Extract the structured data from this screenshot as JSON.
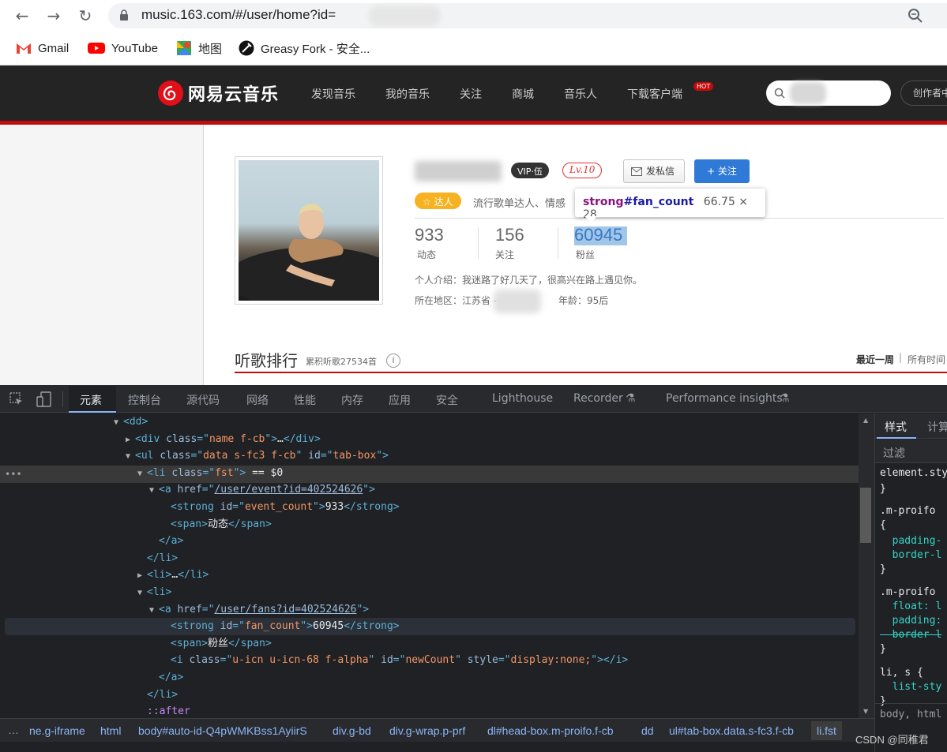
{
  "browser": {
    "url": "music.163.com/#/user/home?id=",
    "bookmarks": [
      {
        "label": "Gmail",
        "icon": "gmail-icon"
      },
      {
        "label": "YouTube",
        "icon": "youtube-icon"
      },
      {
        "label": "地图",
        "icon": "maps-icon"
      },
      {
        "label": "Greasy Fork - 安全...",
        "icon": "greasyfork-icon"
      }
    ]
  },
  "site": {
    "logo": "网易云音乐",
    "nav": [
      "发现音乐",
      "我的音乐",
      "关注",
      "商城",
      "音乐人",
      "下载客户端"
    ],
    "hot_badge": "HOT",
    "creator_center": "创作者中心",
    "brand_color": "#c20c0c"
  },
  "profile": {
    "vip_badge": "VIP·伍",
    "level": "Lv.10",
    "message_button": "发私信",
    "follow_button": "+ 关注",
    "daren_badge": "☆ 达人",
    "description": "流行歌单达人、情感",
    "stats": [
      {
        "value": "933",
        "label": "动态"
      },
      {
        "value": "156",
        "label": "关注"
      },
      {
        "value": "60945",
        "label": "粉丝"
      }
    ],
    "intro": "个人介绍：我迷路了好几天了，很高兴在路上遇见你。",
    "region_label": "所在地区：江苏省 -",
    "age": "年龄：95后"
  },
  "tooltip": {
    "tag": "strong",
    "id": "#fan_count",
    "size": "66.75 × 28"
  },
  "ranking": {
    "title": "听歌排行",
    "subtitle": "累积听歌27534首",
    "info": "i",
    "week": "最近一周",
    "pipe": "|",
    "all": "所有时间"
  },
  "devtools": {
    "tabs": [
      "元素",
      "控制台",
      "源代码",
      "网络",
      "性能",
      "内存",
      "应用",
      "安全",
      "Lighthouse",
      "Recorder",
      "Performance insights"
    ],
    "active_tab": "元素",
    "dom_lines": [
      {
        "indent": 0,
        "tri": "▼",
        "html": "<span class=\"tag\">&lt;dd&gt;</span>"
      },
      {
        "indent": 1,
        "tri": "▶",
        "html": "<span class=\"tag\">&lt;div </span><span class=\"an\">class</span><span class=\"tag\">=\"</span><span class=\"av\">name f-cb</span><span class=\"tag\">\"&gt;</span><span class=\"txt\">…</span><span class=\"tag\">&lt;/div&gt;</span>"
      },
      {
        "indent": 1,
        "tri": "▼",
        "html": "<span class=\"tag\">&lt;ul </span><span class=\"an\">class</span><span class=\"tag\">=\"</span><span class=\"av\">data s-fc3 f-cb</span><span class=\"tag\">\" </span><span class=\"an\">id</span><span class=\"tag\">=\"</span><span class=\"av\">tab-box</span><span class=\"tag\">\"&gt;</span>"
      },
      {
        "indent": 2,
        "tri": "▼",
        "html": "<span class=\"tag\">&lt;li </span><span class=\"an\">class</span><span class=\"tag\">=\"</span><span class=\"av\">fst</span><span class=\"tag\">\"&gt;</span><span class=\"txt\"> == $0</span>"
      },
      {
        "indent": 3,
        "tri": "▼",
        "html": "<span class=\"tag\">&lt;a </span><span class=\"an\">href</span><span class=\"tag\">=\"</span><span class=\"link\">/user/event?id=402524626</span><span class=\"tag\">\"&gt;</span>"
      },
      {
        "indent": 4,
        "tri": "",
        "html": "<span class=\"tag\">&lt;strong </span><span class=\"an\">id</span><span class=\"tag\">=\"</span><span class=\"av\">event_count</span><span class=\"tag\">\"&gt;</span><span class=\"txt\">933</span><span class=\"tag\">&lt;/strong&gt;</span>"
      },
      {
        "indent": 4,
        "tri": "",
        "html": "<span class=\"tag\">&lt;span&gt;</span><span class=\"txt\">动态</span><span class=\"tag\">&lt;/span&gt;</span>"
      },
      {
        "indent": 3,
        "tri": "",
        "html": "<span class=\"tag\">&lt;/a&gt;</span>"
      },
      {
        "indent": 2,
        "tri": "",
        "html": "<span class=\"tag\">&lt;/li&gt;</span>"
      },
      {
        "indent": 2,
        "tri": "▶",
        "html": "<span class=\"tag\">&lt;li&gt;</span><span class=\"txt\">…</span><span class=\"tag\">&lt;/li&gt;</span>"
      },
      {
        "indent": 2,
        "tri": "▼",
        "html": "<span class=\"tag\">&lt;li&gt;</span>"
      },
      {
        "indent": 3,
        "tri": "▼",
        "html": "<span class=\"tag\">&lt;a </span><span class=\"an\">href</span><span class=\"tag\">=\"</span><span class=\"link\">/user/fans?id=402524626</span><span class=\"tag\">\"&gt;</span>"
      },
      {
        "indent": 4,
        "tri": "",
        "html": "<span class=\"tag\">&lt;strong </span><span class=\"an\">id</span><span class=\"tag\">=\"</span><span class=\"av\">fan_count</span><span class=\"tag\">\"&gt;</span><span class=\"txt\">60945</span><span class=\"tag\">&lt;/strong&gt;</span>"
      },
      {
        "indent": 4,
        "tri": "",
        "html": "<span class=\"tag\">&lt;span&gt;</span><span class=\"txt\">粉丝</span><span class=\"tag\">&lt;/span&gt;</span>"
      },
      {
        "indent": 4,
        "tri": "",
        "html": "<span class=\"tag\">&lt;i </span><span class=\"an\">class</span><span class=\"tag\">=\"</span><span class=\"av\">u-icn u-icn-68 f-alpha</span><span class=\"tag\">\" </span><span class=\"an\">id</span><span class=\"tag\">=\"</span><span class=\"av\">newCount</span><span class=\"tag\">\" </span><span class=\"an\">style</span><span class=\"tag\">=\"</span><span class=\"av\">display:none;</span><span class=\"tag\">\"&gt;&lt;/i&gt;</span>"
      },
      {
        "indent": 3,
        "tri": "",
        "html": "<span class=\"tag\">&lt;/a&gt;</span>"
      },
      {
        "indent": 2,
        "tri": "",
        "html": "<span class=\"tag\">&lt;/li&gt;</span>"
      },
      {
        "indent": 2,
        "tri": "",
        "html": "<span class=\"pseudo\">::after</span>"
      }
    ],
    "breadcrumbs": [
      "ne.g-iframe",
      "html",
      "body#auto-id-Q4pWMKBss1AyiirS",
      "div.g-bd",
      "div.g-wrap.p-prf",
      "dl#head-box.m-proifo.f-cb",
      "dd",
      "ul#tab-box.data.s-fc3.f-cb",
      "li.fst"
    ],
    "styles_panel": {
      "tabs": [
        "样式",
        "计算"
      ],
      "filter": "过滤",
      "lines": [
        {
          "text": "element.sty",
          "kind": "sel"
        },
        {
          "text": "}",
          "kind": "sel"
        },
        {
          "text": ".m-proifo",
          "kind": "sel"
        },
        {
          "text": "{",
          "kind": "sel"
        },
        {
          "text": "  padding-",
          "kind": "prop"
        },
        {
          "text": "  border-l",
          "kind": "prop"
        },
        {
          "text": "}",
          "kind": "sel"
        },
        {
          "text": ".m-proifo",
          "kind": "sel"
        },
        {
          "text": "  float: l",
          "kind": "prop"
        },
        {
          "text": "  padding:",
          "kind": "prop"
        },
        {
          "text": "  border-l",
          "kind": "prop"
        },
        {
          "text": "}",
          "kind": "sel"
        },
        {
          "text": "li, s {",
          "kind": "sel"
        },
        {
          "text": "  list-sty",
          "kind": "prop"
        },
        {
          "text": "}",
          "kind": "sel"
        }
      ],
      "footer": "body, html"
    }
  },
  "watermark": "CSDN @同稚君"
}
